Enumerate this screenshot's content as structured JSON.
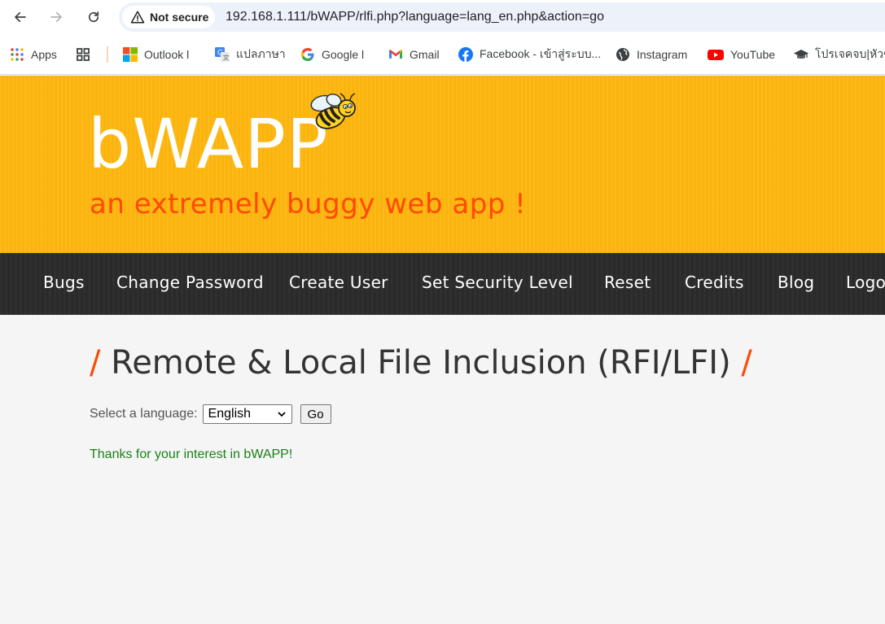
{
  "browser": {
    "security_label": "Not secure",
    "url": "192.168.1.111/bWAPP/rlfi.php?language=lang_en.php&action=go",
    "bookmarks": [
      {
        "label": "Apps",
        "icon": "apps-grid-icon"
      },
      {
        "label": "Outlook l",
        "icon": "microsoft-icon"
      },
      {
        "label": "แปลภาษา",
        "icon": "translate-icon"
      },
      {
        "label": "Google l",
        "icon": "google-icon"
      },
      {
        "label": "Gmail",
        "icon": "gmail-icon"
      },
      {
        "label": "Facebook - เข้าสู่ระบบ...",
        "icon": "facebook-icon"
      },
      {
        "label": "Instagram",
        "icon": "globe-icon"
      },
      {
        "label": "YouTube",
        "icon": "youtube-icon"
      },
      {
        "label": "โปรเจคจบ|หัวข้",
        "icon": "graduation-cap-icon"
      }
    ]
  },
  "header": {
    "logo": "bWAPP",
    "tagline": "an extremely buggy web app !"
  },
  "menu": {
    "items": [
      "Bugs",
      "Change Password",
      "Create User",
      "Set Security Level",
      "Reset",
      "Credits",
      "Blog",
      "Logout"
    ]
  },
  "content": {
    "slash_left": "/",
    "title": "Remote & Local File Inclusion (RFI/LFI)",
    "slash_right": "/",
    "select_label": "Select a language:",
    "select_value": "English",
    "go_label": "Go",
    "message": "Thanks for your interest in bWAPP!"
  },
  "colors": {
    "header_bg": "#ffb70f",
    "tagline": "#ff4a00",
    "menu_bg": "#2b2b2b",
    "message": "#1a7f1a"
  }
}
